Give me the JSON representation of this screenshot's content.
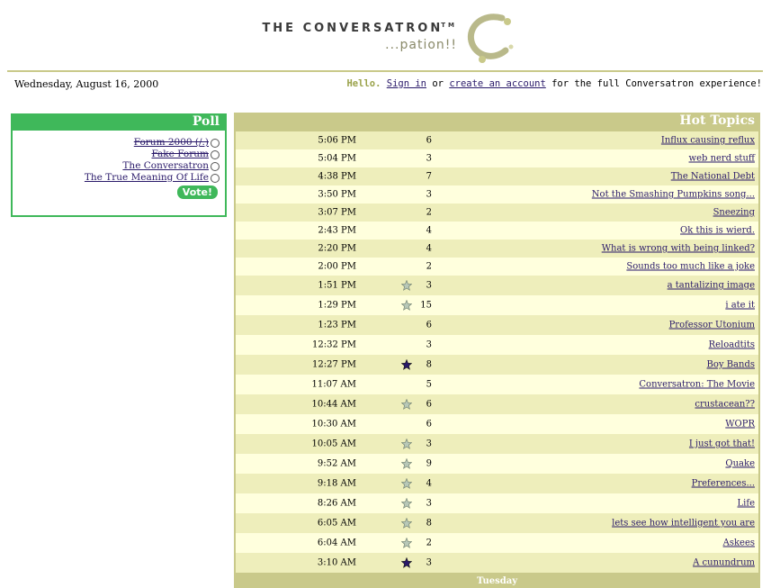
{
  "header": {
    "logo_title": "THE CONVERSATRON",
    "logo_tm": "TM",
    "logo_tagline": "...pation!!"
  },
  "date_text": "Wednesday, August 16, 2000",
  "welcome": {
    "hello": "Hello.",
    "sign_in": "Sign in",
    "or": " or ",
    "create_account": "create an account",
    "rest": " for the full Conversatron experience!"
  },
  "poll": {
    "title": "Poll",
    "options": [
      {
        "label": "Forum 2000 (/.)",
        "struck": true
      },
      {
        "label": "Fake Forum",
        "struck": true
      },
      {
        "label": "The Conversatron",
        "struck": false
      },
      {
        "label": "The True Meaning Of Life",
        "struck": false
      }
    ],
    "vote_label": "Vote!"
  },
  "topics": {
    "title": "Hot Topics",
    "rows": [
      {
        "title": "Influx causing reflux",
        "count": "6",
        "time": "5:06 PM",
        "star": ""
      },
      {
        "title": "web nerd stuff",
        "count": "3",
        "time": "5:04 PM",
        "star": ""
      },
      {
        "title": "The National Debt",
        "count": "7",
        "time": "4:38 PM",
        "star": ""
      },
      {
        "title": "Not the Smashing Pumpkins song...",
        "count": "3",
        "time": "3:50 PM",
        "star": ""
      },
      {
        "title": "Sneezing",
        "count": "2",
        "time": "3:07 PM",
        "star": ""
      },
      {
        "title": "Ok this is wierd.",
        "count": "4",
        "time": "2:43 PM",
        "star": ""
      },
      {
        "title": "What is wrong with being linked?",
        "count": "4",
        "time": "2:20 PM",
        "star": ""
      },
      {
        "title": "Sounds too much like a joke",
        "count": "2",
        "time": "2:00 PM",
        "star": ""
      },
      {
        "title": "a tantalizing image",
        "count": "3",
        "time": "1:51 PM",
        "star": "light"
      },
      {
        "title": "i ate it",
        "count": "15",
        "time": "1:29 PM",
        "star": "light"
      },
      {
        "title": "Professor Utonium",
        "count": "6",
        "time": "1:23 PM",
        "star": ""
      },
      {
        "title": "Reloadtits",
        "count": "3",
        "time": "12:32 PM",
        "star": ""
      },
      {
        "title": "Boy Bands",
        "count": "8",
        "time": "12:27 PM",
        "star": "dark"
      },
      {
        "title": "Conversatron: The Movie",
        "count": "5",
        "time": "11:07 AM",
        "star": ""
      },
      {
        "title": "crustacean??",
        "count": "6",
        "time": "10:44 AM",
        "star": "light"
      },
      {
        "title": "WOPR",
        "count": "6",
        "time": "10:30 AM",
        "star": ""
      },
      {
        "title": "I just got that!",
        "count": "3",
        "time": "10:05 AM",
        "star": "light"
      },
      {
        "title": "Quake",
        "count": "9",
        "time": "9:52 AM",
        "star": "light"
      },
      {
        "title": "Preferences...",
        "count": "4",
        "time": "9:18 AM",
        "star": "light"
      },
      {
        "title": "Life",
        "count": "3",
        "time": "8:26 AM",
        "star": "light"
      },
      {
        "title": "lets see how intelligent you are",
        "count": "8",
        "time": "6:05 AM",
        "star": "light"
      },
      {
        "title": "Askees",
        "count": "2",
        "time": "6:04 AM",
        "star": "light"
      },
      {
        "title": "A cunundrum",
        "count": "3",
        "time": "3:10 AM",
        "star": "dark"
      }
    ],
    "day_label": "Tuesday"
  },
  "colors": {
    "accent_green": "#3fb85a",
    "olive": "#c9c98a",
    "row_odd": "#eeeebb",
    "row_even": "#ffffdd",
    "link": "#2a1a6a"
  }
}
